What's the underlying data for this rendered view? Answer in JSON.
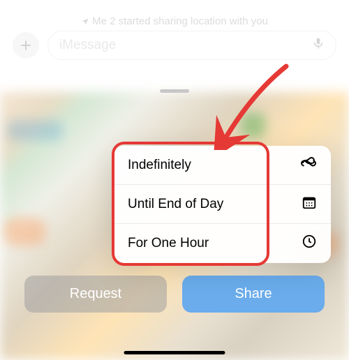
{
  "status": {
    "text": "Me 2 started sharing location with you"
  },
  "message_input": {
    "placeholder": "iMessage"
  },
  "menu": {
    "items": [
      {
        "label": "Indefinitely",
        "icon": "infinity"
      },
      {
        "label": "Until End of Day",
        "icon": "calendar"
      },
      {
        "label": "For One Hour",
        "icon": "clock"
      }
    ]
  },
  "buttons": {
    "request": "Request",
    "share": "Share"
  }
}
